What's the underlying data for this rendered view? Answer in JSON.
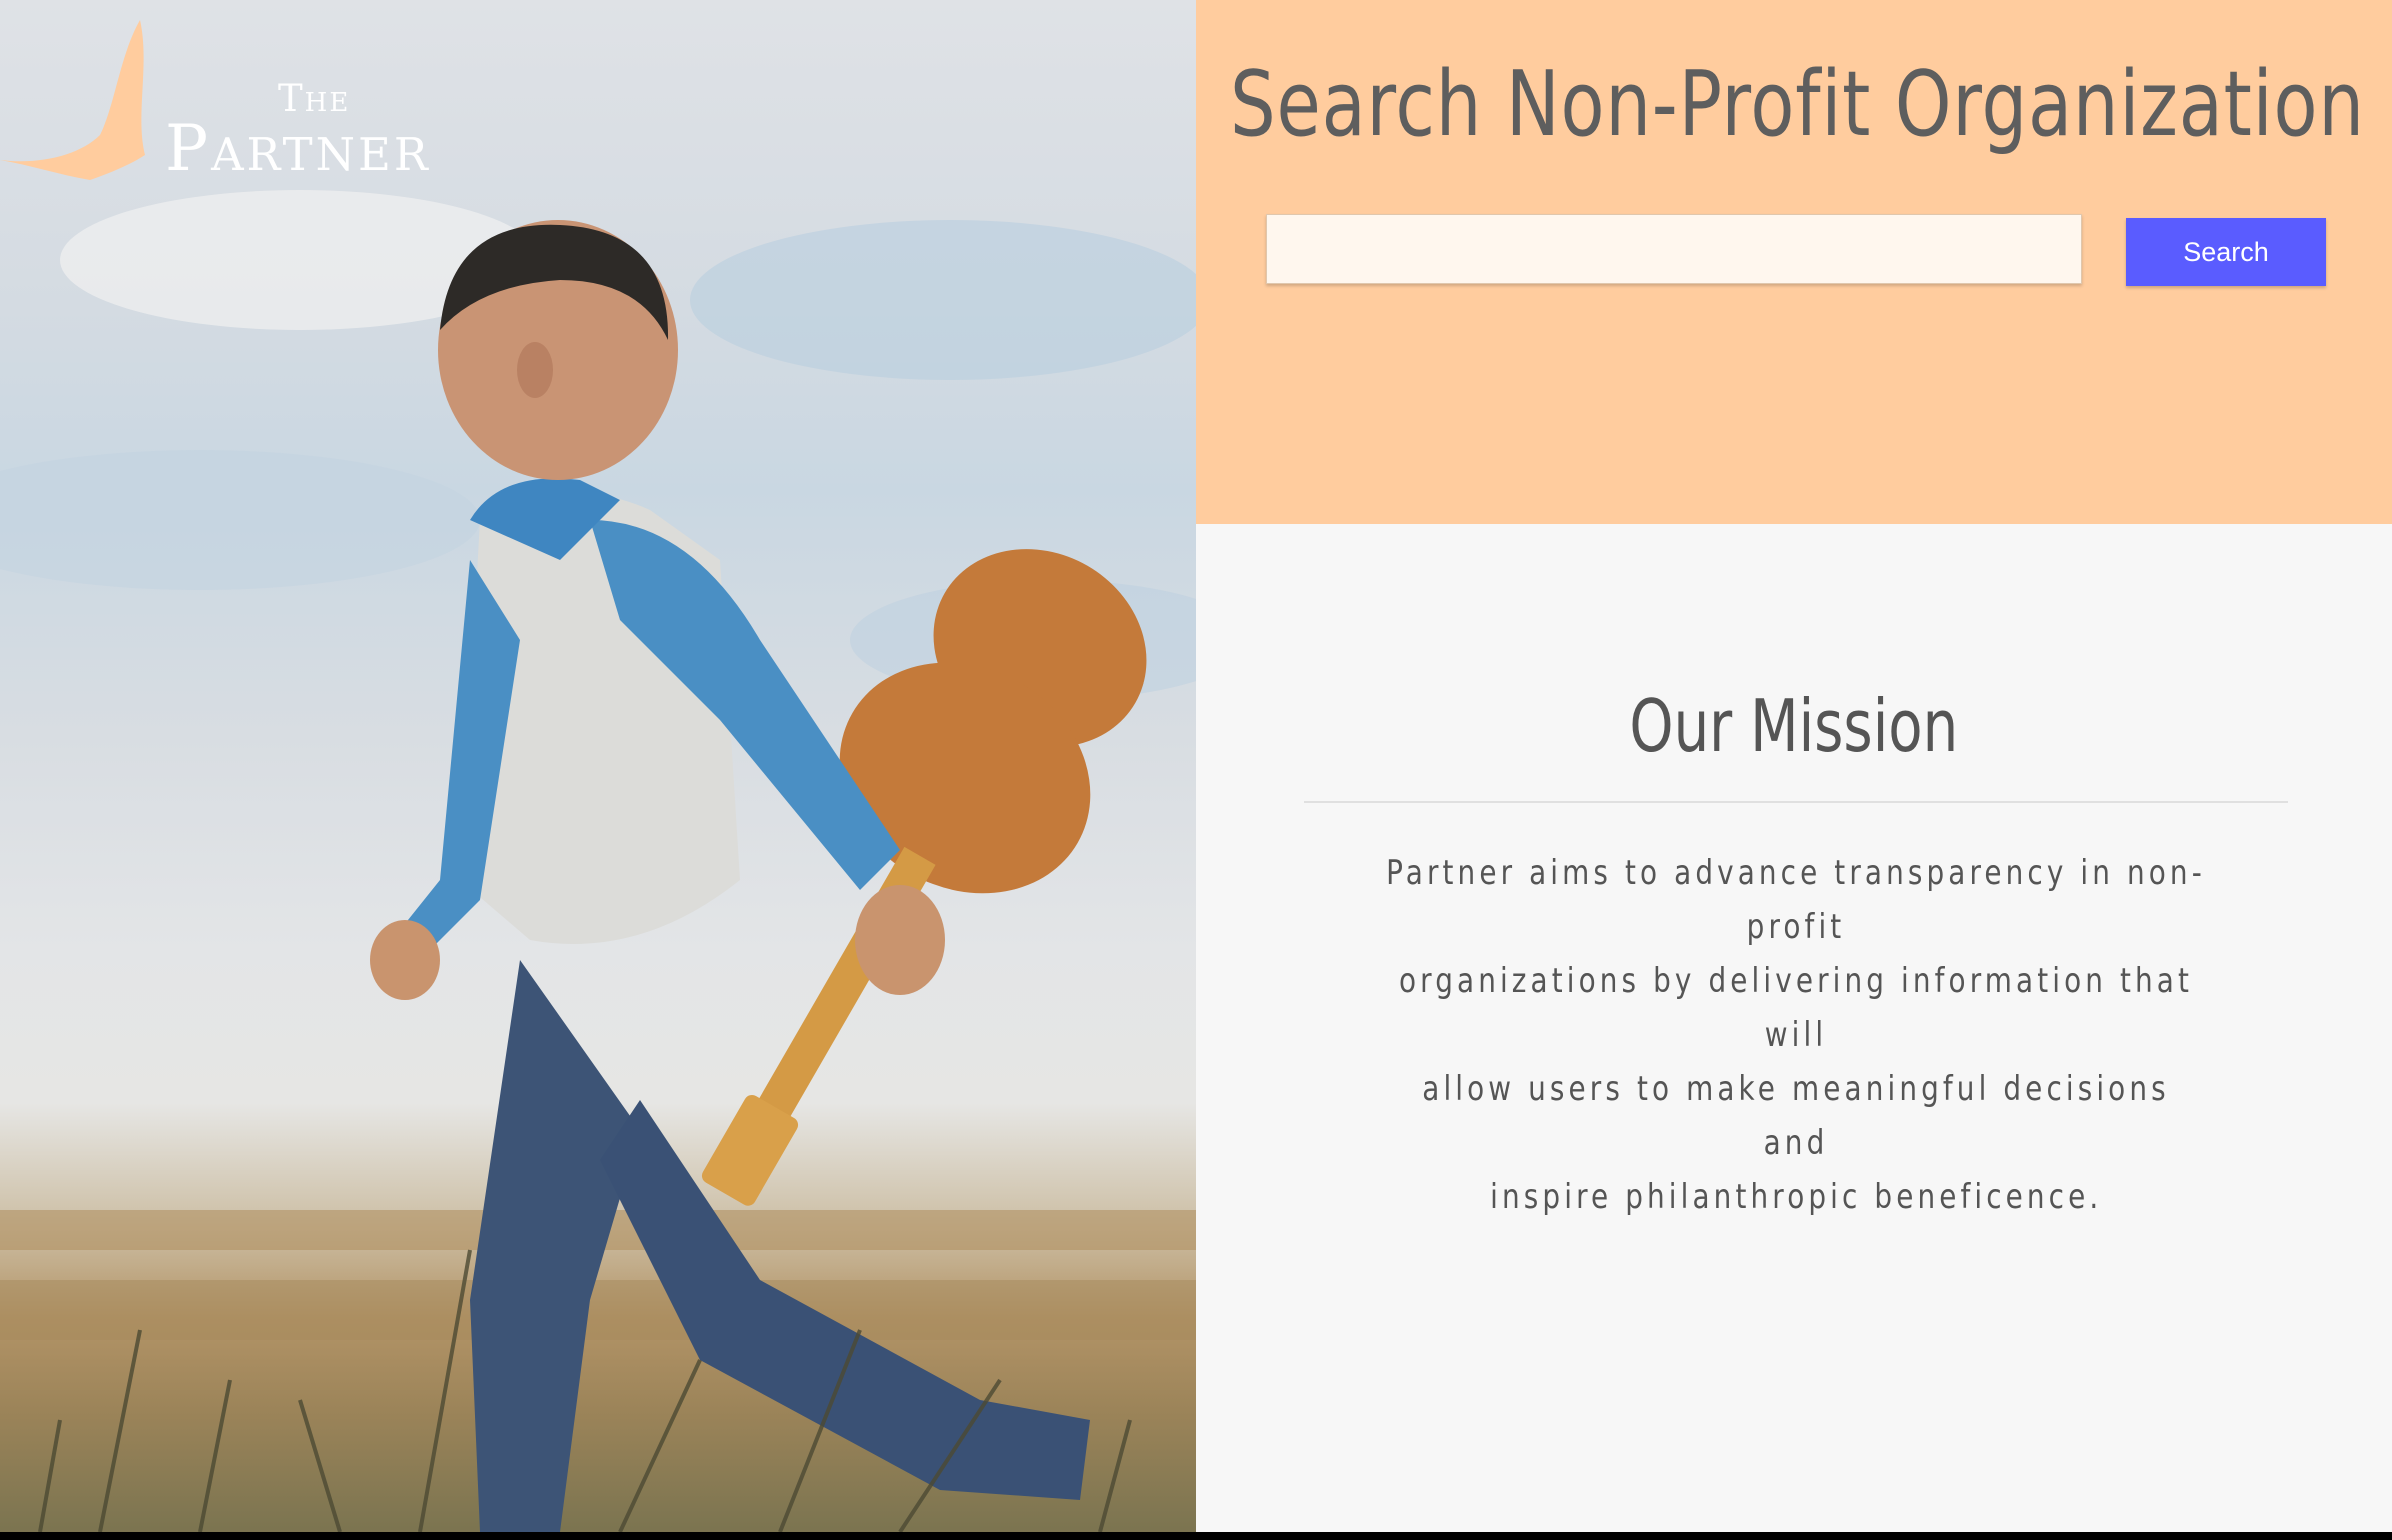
{
  "logo": {
    "line1": "The",
    "line2": "Partner",
    "icon": "bird-icon",
    "icon_color": "#ffcc9e"
  },
  "hero": {
    "image": "boy-with-guitar-photo"
  },
  "search": {
    "title": "Search Non-Profit Organization",
    "input_value": "",
    "input_placeholder": "",
    "button_label": "Search",
    "panel_color": "#ffcc9e",
    "button_color": "#5a5cff"
  },
  "mission": {
    "title": "Our Mission",
    "lines": [
      "Partner aims to advance transparency in non-profit",
      "organizations by delivering information that will",
      "allow users to make meaningful decisions and",
      "inspire philanthropic beneficence."
    ]
  }
}
